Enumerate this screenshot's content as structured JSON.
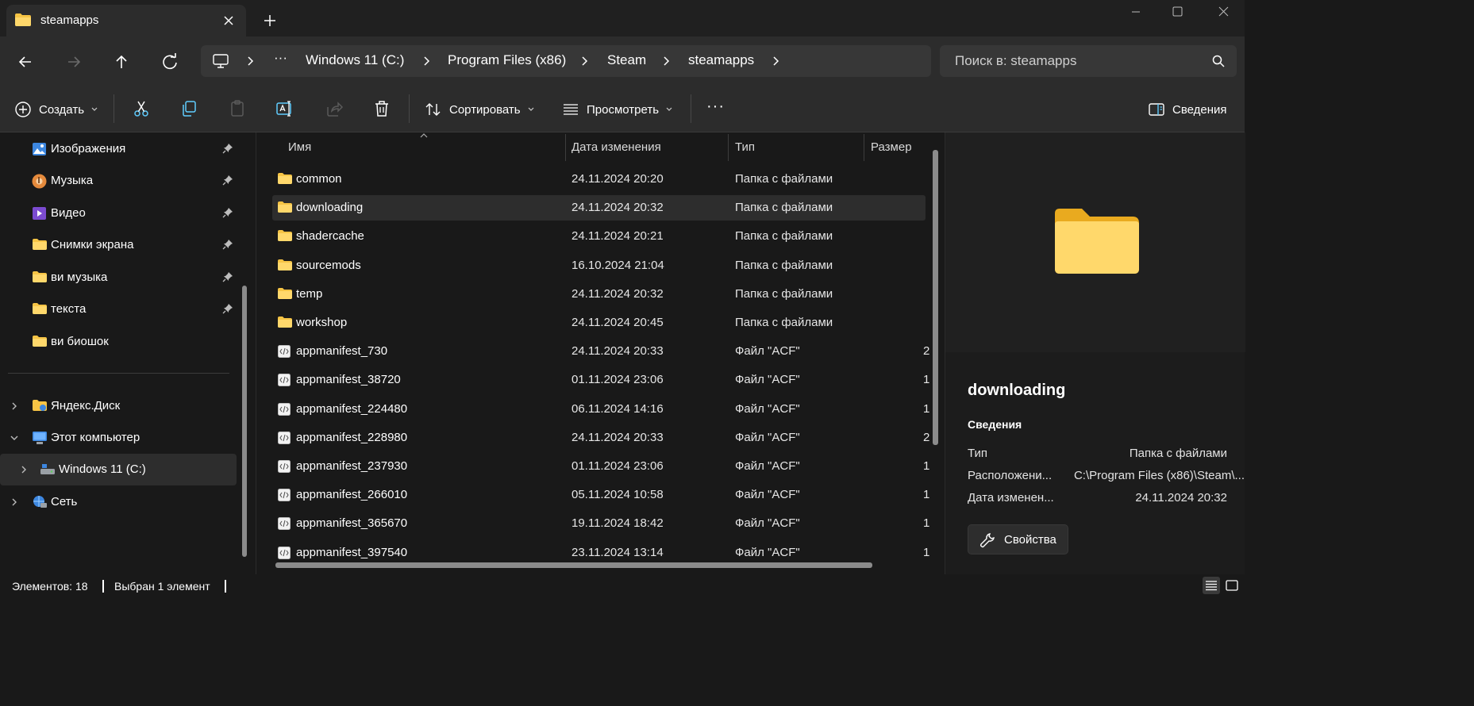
{
  "tab": {
    "title": "steamapps"
  },
  "address": {
    "crumbs": [
      "Windows 11 (C:)",
      "Program Files (x86)",
      "Steam",
      "steamapps"
    ],
    "ellipsis": "···"
  },
  "search": {
    "placeholder": "Поиск в: steamapps"
  },
  "toolbar": {
    "create": "Создать",
    "sort": "Сортировать",
    "view": "Просмотреть",
    "more": "···",
    "details": "Сведения"
  },
  "sidebar": {
    "items": [
      {
        "label": "Изображения"
      },
      {
        "label": "Музыка"
      },
      {
        "label": "Видео"
      },
      {
        "label": "Снимки экрана"
      },
      {
        "label": "ви музыка"
      },
      {
        "label": "текста"
      },
      {
        "label": "ви биошок"
      },
      {
        "label": "Яндекс.Диск"
      },
      {
        "label": "Этот компьютер"
      },
      {
        "label": "Windows 11 (C:)"
      },
      {
        "label": "Сеть"
      }
    ]
  },
  "columns": {
    "name": "Имя",
    "date": "Дата изменения",
    "type": "Тип",
    "size": "Размер"
  },
  "files": [
    {
      "name": "common",
      "date": "24.11.2024 20:20",
      "type": "Папка с файлами",
      "size": "",
      "kind": "folder"
    },
    {
      "name": "downloading",
      "date": "24.11.2024 20:32",
      "type": "Папка с файлами",
      "size": "",
      "kind": "folder"
    },
    {
      "name": "shadercache",
      "date": "24.11.2024 20:21",
      "type": "Папка с файлами",
      "size": "",
      "kind": "folder"
    },
    {
      "name": "sourcemods",
      "date": "16.10.2024 21:04",
      "type": "Папка с файлами",
      "size": "",
      "kind": "folder"
    },
    {
      "name": "temp",
      "date": "24.11.2024 20:32",
      "type": "Папка с файлами",
      "size": "",
      "kind": "folder"
    },
    {
      "name": "workshop",
      "date": "24.11.2024 20:45",
      "type": "Папка с файлами",
      "size": "",
      "kind": "folder"
    },
    {
      "name": "appmanifest_730",
      "date": "24.11.2024 20:33",
      "type": "Файл \"ACF\"",
      "size": "2",
      "kind": "file"
    },
    {
      "name": "appmanifest_38720",
      "date": "01.11.2024 23:06",
      "type": "Файл \"ACF\"",
      "size": "1",
      "kind": "file"
    },
    {
      "name": "appmanifest_224480",
      "date": "06.11.2024 14:16",
      "type": "Файл \"ACF\"",
      "size": "1",
      "kind": "file"
    },
    {
      "name": "appmanifest_228980",
      "date": "24.11.2024 20:33",
      "type": "Файл \"ACF\"",
      "size": "2",
      "kind": "file"
    },
    {
      "name": "appmanifest_237930",
      "date": "01.11.2024 23:06",
      "type": "Файл \"ACF\"",
      "size": "1",
      "kind": "file"
    },
    {
      "name": "appmanifest_266010",
      "date": "05.11.2024 10:58",
      "type": "Файл \"ACF\"",
      "size": "1",
      "kind": "file"
    },
    {
      "name": "appmanifest_365670",
      "date": "19.11.2024 18:42",
      "type": "Файл \"ACF\"",
      "size": "1",
      "kind": "file"
    },
    {
      "name": "appmanifest_397540",
      "date": "23.11.2024 13:14",
      "type": "Файл \"ACF\"",
      "size": "1",
      "kind": "file"
    }
  ],
  "details": {
    "title": "downloading",
    "section": "Сведения",
    "props": [
      {
        "key": "Тип",
        "value": "Папка с файлами"
      },
      {
        "key": "Расположени...",
        "value": "C:\\Program Files (x86)\\Steam\\..."
      },
      {
        "key": "Дата изменен...",
        "value": "24.11.2024 20:32"
      }
    ],
    "properties_button": "Свойства"
  },
  "status": {
    "count": "Элементов: 18",
    "selected": "Выбран 1 элемент"
  },
  "colors": {
    "folder": "#f6c445",
    "accent": "#60cdff",
    "background": "#191919"
  }
}
